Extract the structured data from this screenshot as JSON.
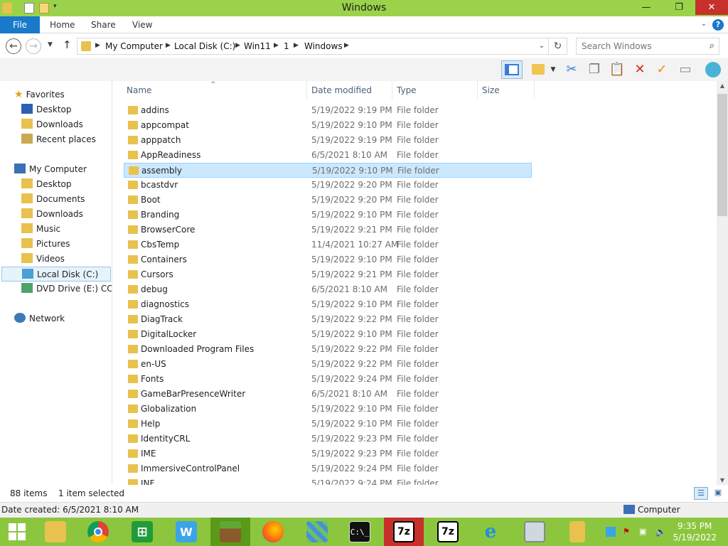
{
  "window": {
    "title": "Windows",
    "minimize_glyph": "—",
    "maximize_glyph": "❐",
    "close_glyph": "✕"
  },
  "ribbon": {
    "tabs": [
      "File",
      "Home",
      "Share",
      "View"
    ]
  },
  "address": {
    "breadcrumbs": [
      "My Computer",
      "Local Disk (C:)",
      "Win11",
      "1",
      "Windows"
    ],
    "search_placeholder": "Search Windows"
  },
  "nav": {
    "favorites_label": "Favorites",
    "favorites": [
      "Desktop",
      "Downloads",
      "Recent places"
    ],
    "computer_label": "My Computer",
    "computer": [
      "Desktop",
      "Documents",
      "Downloads",
      "Music",
      "Pictures",
      "Videos",
      "Local Disk (C:)",
      "DVD Drive (E:) CCCC"
    ],
    "network_label": "Network"
  },
  "columns": {
    "name": "Name",
    "date": "Date modified",
    "type": "Type",
    "size": "Size"
  },
  "files": [
    {
      "name": "addins",
      "date": "5/19/2022 9:19 PM",
      "type": "File folder"
    },
    {
      "name": "appcompat",
      "date": "5/19/2022 9:10 PM",
      "type": "File folder"
    },
    {
      "name": "apppatch",
      "date": "5/19/2022 9:19 PM",
      "type": "File folder"
    },
    {
      "name": "AppReadiness",
      "date": "6/5/2021 8:10 AM",
      "type": "File folder"
    },
    {
      "name": "assembly",
      "date": "5/19/2022 9:10 PM",
      "type": "File folder"
    },
    {
      "name": "bcastdvr",
      "date": "5/19/2022 9:20 PM",
      "type": "File folder"
    },
    {
      "name": "Boot",
      "date": "5/19/2022 9:20 PM",
      "type": "File folder"
    },
    {
      "name": "Branding",
      "date": "5/19/2022 9:10 PM",
      "type": "File folder"
    },
    {
      "name": "BrowserCore",
      "date": "5/19/2022 9:21 PM",
      "type": "File folder"
    },
    {
      "name": "CbsTemp",
      "date": "11/4/2021 10:27 AM",
      "type": "File folder"
    },
    {
      "name": "Containers",
      "date": "5/19/2022 9:10 PM",
      "type": "File folder"
    },
    {
      "name": "Cursors",
      "date": "5/19/2022 9:21 PM",
      "type": "File folder"
    },
    {
      "name": "debug",
      "date": "6/5/2021 8:10 AM",
      "type": "File folder"
    },
    {
      "name": "diagnostics",
      "date": "5/19/2022 9:10 PM",
      "type": "File folder"
    },
    {
      "name": "DiagTrack",
      "date": "5/19/2022 9:22 PM",
      "type": "File folder"
    },
    {
      "name": "DigitalLocker",
      "date": "5/19/2022 9:10 PM",
      "type": "File folder"
    },
    {
      "name": "Downloaded Program Files",
      "date": "5/19/2022 9:22 PM",
      "type": "File folder"
    },
    {
      "name": "en-US",
      "date": "5/19/2022 9:22 PM",
      "type": "File folder"
    },
    {
      "name": "Fonts",
      "date": "5/19/2022 9:24 PM",
      "type": "File folder"
    },
    {
      "name": "GameBarPresenceWriter",
      "date": "6/5/2021 8:10 AM",
      "type": "File folder"
    },
    {
      "name": "Globalization",
      "date": "5/19/2022 9:10 PM",
      "type": "File folder"
    },
    {
      "name": "Help",
      "date": "5/19/2022 9:10 PM",
      "type": "File folder"
    },
    {
      "name": "IdentityCRL",
      "date": "5/19/2022 9:23 PM",
      "type": "File folder"
    },
    {
      "name": "IME",
      "date": "5/19/2022 9:23 PM",
      "type": "File folder"
    },
    {
      "name": "ImmersiveControlPanel",
      "date": "5/19/2022 9:24 PM",
      "type": "File folder"
    },
    {
      "name": "INF",
      "date": "5/19/2022 9:24 PM",
      "type": "File folder"
    }
  ],
  "status": {
    "item_count": "88 items",
    "selected": "1 item selected",
    "details": "Date created: 6/5/2021 8:10 AM",
    "location": "Computer"
  },
  "taskbar": {
    "time": "9:35 PM",
    "date": "5/19/2022",
    "apps": [
      "file-manager",
      "chrome",
      "store",
      "app-w",
      "minecraft",
      "firefox",
      "cubes",
      "cmd",
      "7zip",
      "7zip",
      "internet-explorer",
      "monitor",
      "explorer-folder"
    ],
    "cmd_text": "C:\\_",
    "zip_text": "7z",
    "store_text": "⊞",
    "w_text": "W"
  },
  "colors": {
    "titlebar": "#9ad34a",
    "taskbar": "#8cc63f",
    "accent": "#1979ca",
    "selection": "#cce8ff"
  }
}
